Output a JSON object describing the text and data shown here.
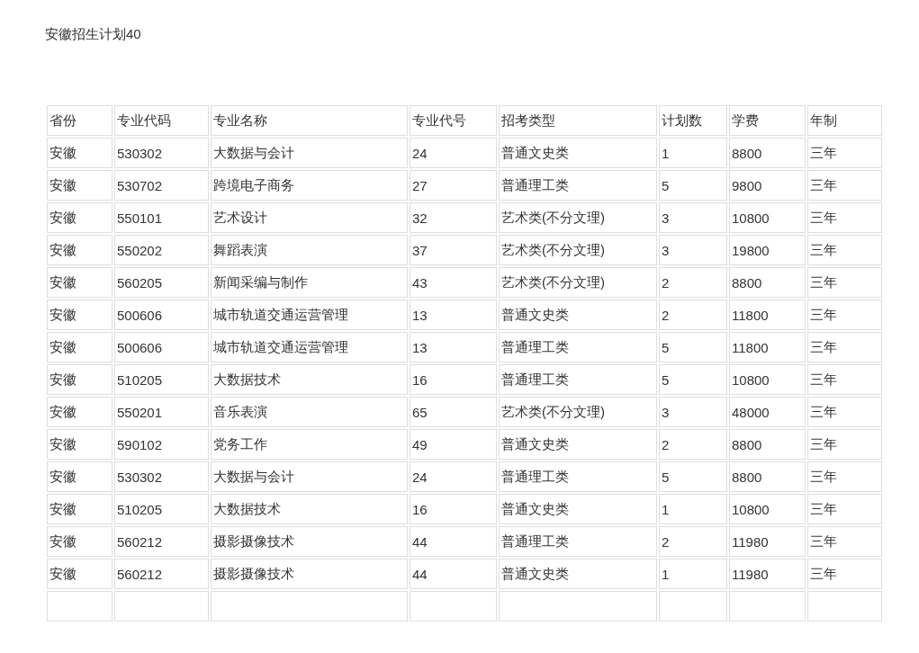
{
  "title": "安徽招生计划40",
  "table": {
    "columns": [
      "省份",
      "专业代码",
      "专业名称",
      "专业代号",
      "招考类型",
      "计划数",
      "学费",
      "年制"
    ],
    "rows": [
      [
        "安徽",
        "530302",
        "大数据与会计",
        "24",
        "普通文史类",
        "1",
        "8800",
        "三年"
      ],
      [
        "安徽",
        "530702",
        "跨境电子商务",
        "27",
        "普通理工类",
        "5",
        "9800",
        "三年"
      ],
      [
        "安徽",
        "550101",
        "艺术设计",
        "32",
        "艺术类(不分文理)",
        "3",
        "10800",
        "三年"
      ],
      [
        "安徽",
        "550202",
        "舞蹈表演",
        "37",
        "艺术类(不分文理)",
        "3",
        "19800",
        "三年"
      ],
      [
        "安徽",
        "560205",
        "新闻采编与制作",
        "43",
        "艺术类(不分文理)",
        "2",
        "8800",
        "三年"
      ],
      [
        "安徽",
        "500606",
        "城市轨道交通运营管理",
        "13",
        "普通文史类",
        "2",
        "11800",
        "三年"
      ],
      [
        "安徽",
        "500606",
        "城市轨道交通运营管理",
        "13",
        "普通理工类",
        "5",
        "11800",
        "三年"
      ],
      [
        "安徽",
        "510205",
        "大数据技术",
        "16",
        "普通理工类",
        "5",
        "10800",
        "三年"
      ],
      [
        "安徽",
        "550201",
        "音乐表演",
        "65",
        "艺术类(不分文理)",
        "3",
        "48000",
        "三年"
      ],
      [
        "安徽",
        "590102",
        "党务工作",
        "49",
        "普通文史类",
        "2",
        "8800",
        "三年"
      ],
      [
        "安徽",
        "530302",
        "大数据与会计",
        "24",
        "普通理工类",
        "5",
        "8800",
        "三年"
      ],
      [
        "安徽",
        "510205",
        "大数据技术",
        "16",
        "普通文史类",
        "1",
        "10800",
        "三年"
      ],
      [
        "安徽",
        "560212",
        "摄影摄像技术",
        "44",
        "普通理工类",
        "2",
        "11980",
        "三年"
      ],
      [
        "安徽",
        "560212",
        "摄影摄像技术",
        "44",
        "普通文史类",
        "1",
        "11980",
        "三年"
      ]
    ],
    "trailing_blank_row": true
  }
}
